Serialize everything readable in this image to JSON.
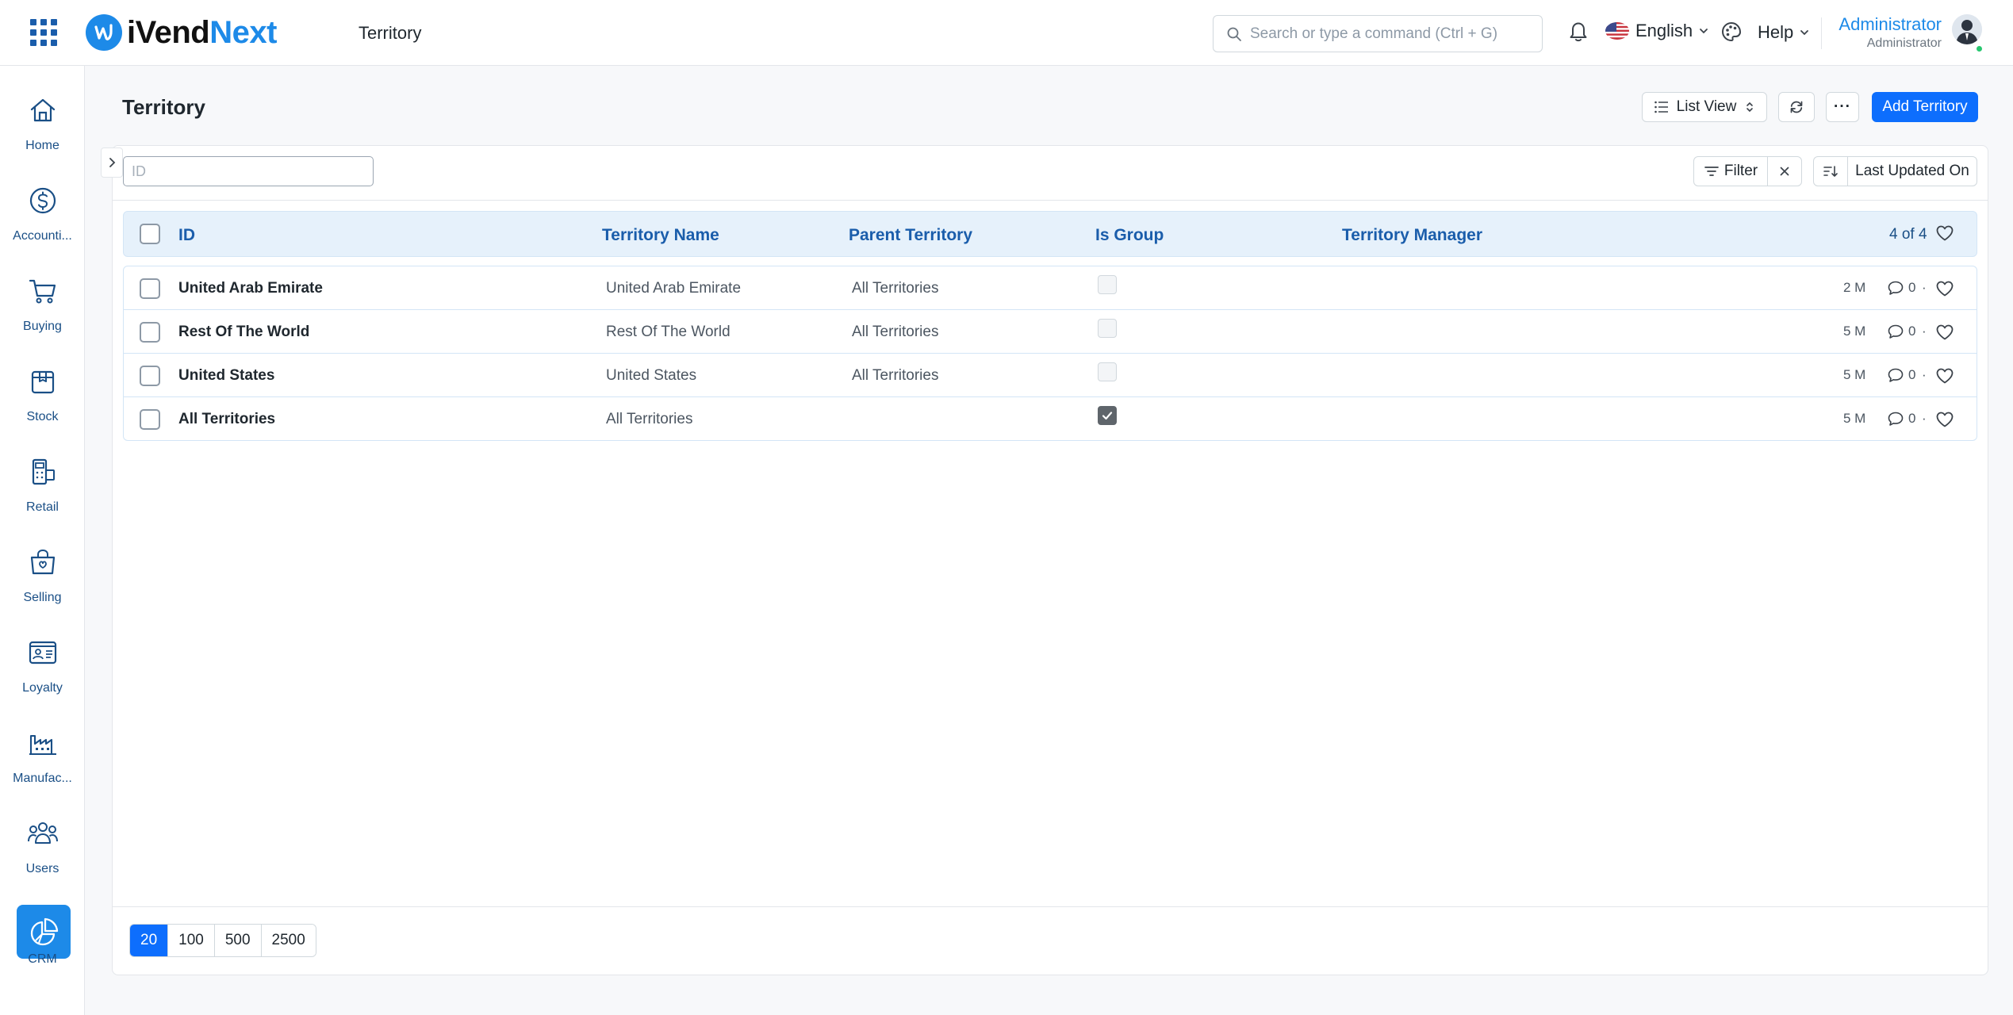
{
  "topbar": {
    "logo_part1": "iVend",
    "logo_part2": "Next",
    "breadcrumb": "Territory",
    "search_placeholder": "Search or type a command (Ctrl + G)",
    "language": "English",
    "help": "Help",
    "user_name": "Administrator",
    "user_role": "Administrator"
  },
  "sidebar": {
    "items": [
      {
        "label": "Home",
        "icon": "home-icon"
      },
      {
        "label": "Accounti...",
        "icon": "dollar-icon"
      },
      {
        "label": "Buying",
        "icon": "cart-icon"
      },
      {
        "label": "Stock",
        "icon": "box-icon"
      },
      {
        "label": "Retail",
        "icon": "pos-icon"
      },
      {
        "label": "Selling",
        "icon": "shopping-bag-icon"
      },
      {
        "label": "Loyalty",
        "icon": "id-card-icon"
      },
      {
        "label": "Manufac...",
        "icon": "factory-icon"
      },
      {
        "label": "Users",
        "icon": "users-icon"
      },
      {
        "label": "CRM",
        "icon": "pie-chart-icon",
        "active": true
      }
    ]
  },
  "page": {
    "title": "Territory",
    "list_view_label": "List View",
    "more_label": "···",
    "add_label": "Add Territory",
    "id_filter_placeholder": "ID",
    "filter_label": "Filter",
    "sort_label": "Last Updated On"
  },
  "table": {
    "columns": [
      "ID",
      "Territory Name",
      "Parent Territory",
      "Is Group",
      "Territory Manager"
    ],
    "count": "4 of 4",
    "rows": [
      {
        "id": "United Arab Emirate",
        "name": "United Arab Emirate",
        "parent": "All Territories",
        "is_group": false,
        "manager": "",
        "modified": "2 M",
        "comments": "0"
      },
      {
        "id": "Rest Of The World",
        "name": "Rest Of The World",
        "parent": "All Territories",
        "is_group": false,
        "manager": "",
        "modified": "5 M",
        "comments": "0"
      },
      {
        "id": "United States",
        "name": "United States",
        "parent": "All Territories",
        "is_group": false,
        "manager": "",
        "modified": "5 M",
        "comments": "0"
      },
      {
        "id": "All Territories",
        "name": "All Territories",
        "parent": "",
        "is_group": true,
        "manager": "",
        "modified": "5 M",
        "comments": "0"
      }
    ]
  },
  "pager": {
    "sizes": [
      "20",
      "100",
      "500",
      "2500"
    ],
    "selected": "20"
  },
  "colors": {
    "accent": "#0d6efd",
    "brand": "#1d8ae8",
    "header_bg": "#e6f1fb",
    "header_text": "#1a5dab"
  }
}
